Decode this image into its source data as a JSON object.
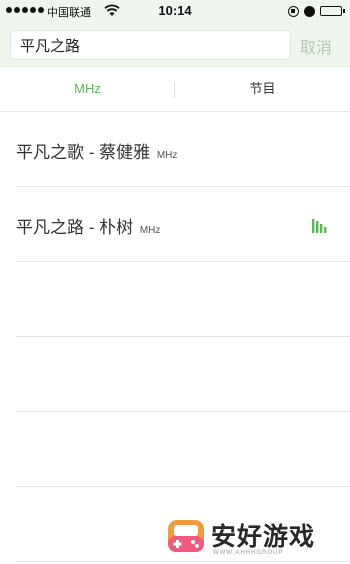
{
  "status_bar": {
    "carrier": "中国联通",
    "time": "10:14",
    "battery_level": 1.0,
    "colors": {
      "battery": "#3cc14a"
    }
  },
  "search": {
    "value": "平凡之路",
    "cancel_label": "取消"
  },
  "tabs": [
    {
      "label": "MHz",
      "active": true
    },
    {
      "label": "节目",
      "active": false
    }
  ],
  "results": [
    {
      "title": "平凡之歌 - 蔡健雅",
      "unit": "MHz",
      "playing": false
    },
    {
      "title": "平凡之路 - 朴树",
      "unit": "MHz",
      "playing": true,
      "icon": "playing-bars-icon"
    }
  ],
  "watermark": {
    "text": "安好游戏",
    "subtext": "WWW.AHHHGROUP",
    "icon": "gamepad-icon"
  },
  "colors": {
    "accent": "#5eb55a",
    "header_bg": "#f0f6ee",
    "cancel_text": "#b4c7b0"
  }
}
